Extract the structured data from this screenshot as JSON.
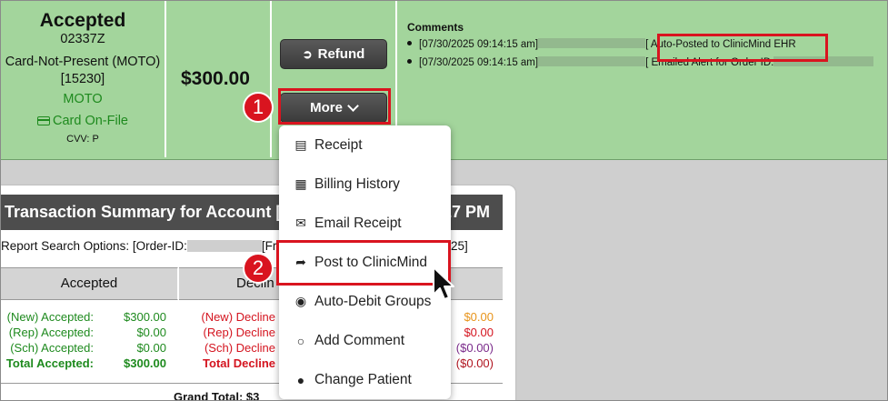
{
  "transaction": {
    "status": "Accepted",
    "code": "02337Z",
    "entry_mode": "Card-Not-Present (MOTO)",
    "terminal": "[15230]",
    "channel": "MOTO",
    "card_on_file": "Card On-File",
    "cvv": "CVV: P",
    "amount": "$300.00"
  },
  "actions": {
    "refund_label": "Refund",
    "more_label": "More"
  },
  "comments": {
    "title": "Comments",
    "items": [
      {
        "timestamp": "[07/30/2025 09:14:15 am]",
        "text": "[ Auto-Posted to ClinicMind EHR"
      },
      {
        "timestamp": "[07/30/2025 09:14:15 am]",
        "text": "[ Emailed Alert for Order ID:"
      }
    ]
  },
  "badges": {
    "one": "1",
    "two": "2"
  },
  "dropdown": {
    "items": [
      {
        "label": "Receipt",
        "icon": "receipt-icon"
      },
      {
        "label": "Billing History",
        "icon": "calendar-icon"
      },
      {
        "label": "Email Receipt",
        "icon": "envelope-icon"
      },
      {
        "label": "Post to ClinicMind",
        "icon": "share-icon"
      },
      {
        "label": "Auto-Debit Groups",
        "icon": "group-icon"
      },
      {
        "label": "Add Comment",
        "icon": "comment-icon"
      },
      {
        "label": "Change Patient",
        "icon": "user-icon"
      }
    ]
  },
  "summary": {
    "title_left": "Transaction Summary for Account [65",
    "title_right": "27 PM",
    "options_left": "Report Search Options: [Order-ID:",
    "options_mid": "[Fro",
    "options_right": "25]",
    "col_accepted": "Accepted",
    "col_declined": "Declin",
    "accepted_labels": [
      "(New) Accepted:",
      "(Rep) Accepted:",
      "(Sch) Accepted:",
      "Total Accepted:"
    ],
    "accepted_values": [
      "$300.00",
      "$0.00",
      "$0.00",
      "$300.00"
    ],
    "declined_labels": [
      "(New) Decline",
      "(Rep) Decline",
      "(Sch) Decline",
      "Total Decline"
    ],
    "right_values": [
      "$0.00",
      "$0.00",
      "($0.00)",
      "($0.00)"
    ],
    "grand_total": "Grand Total: $3"
  }
}
